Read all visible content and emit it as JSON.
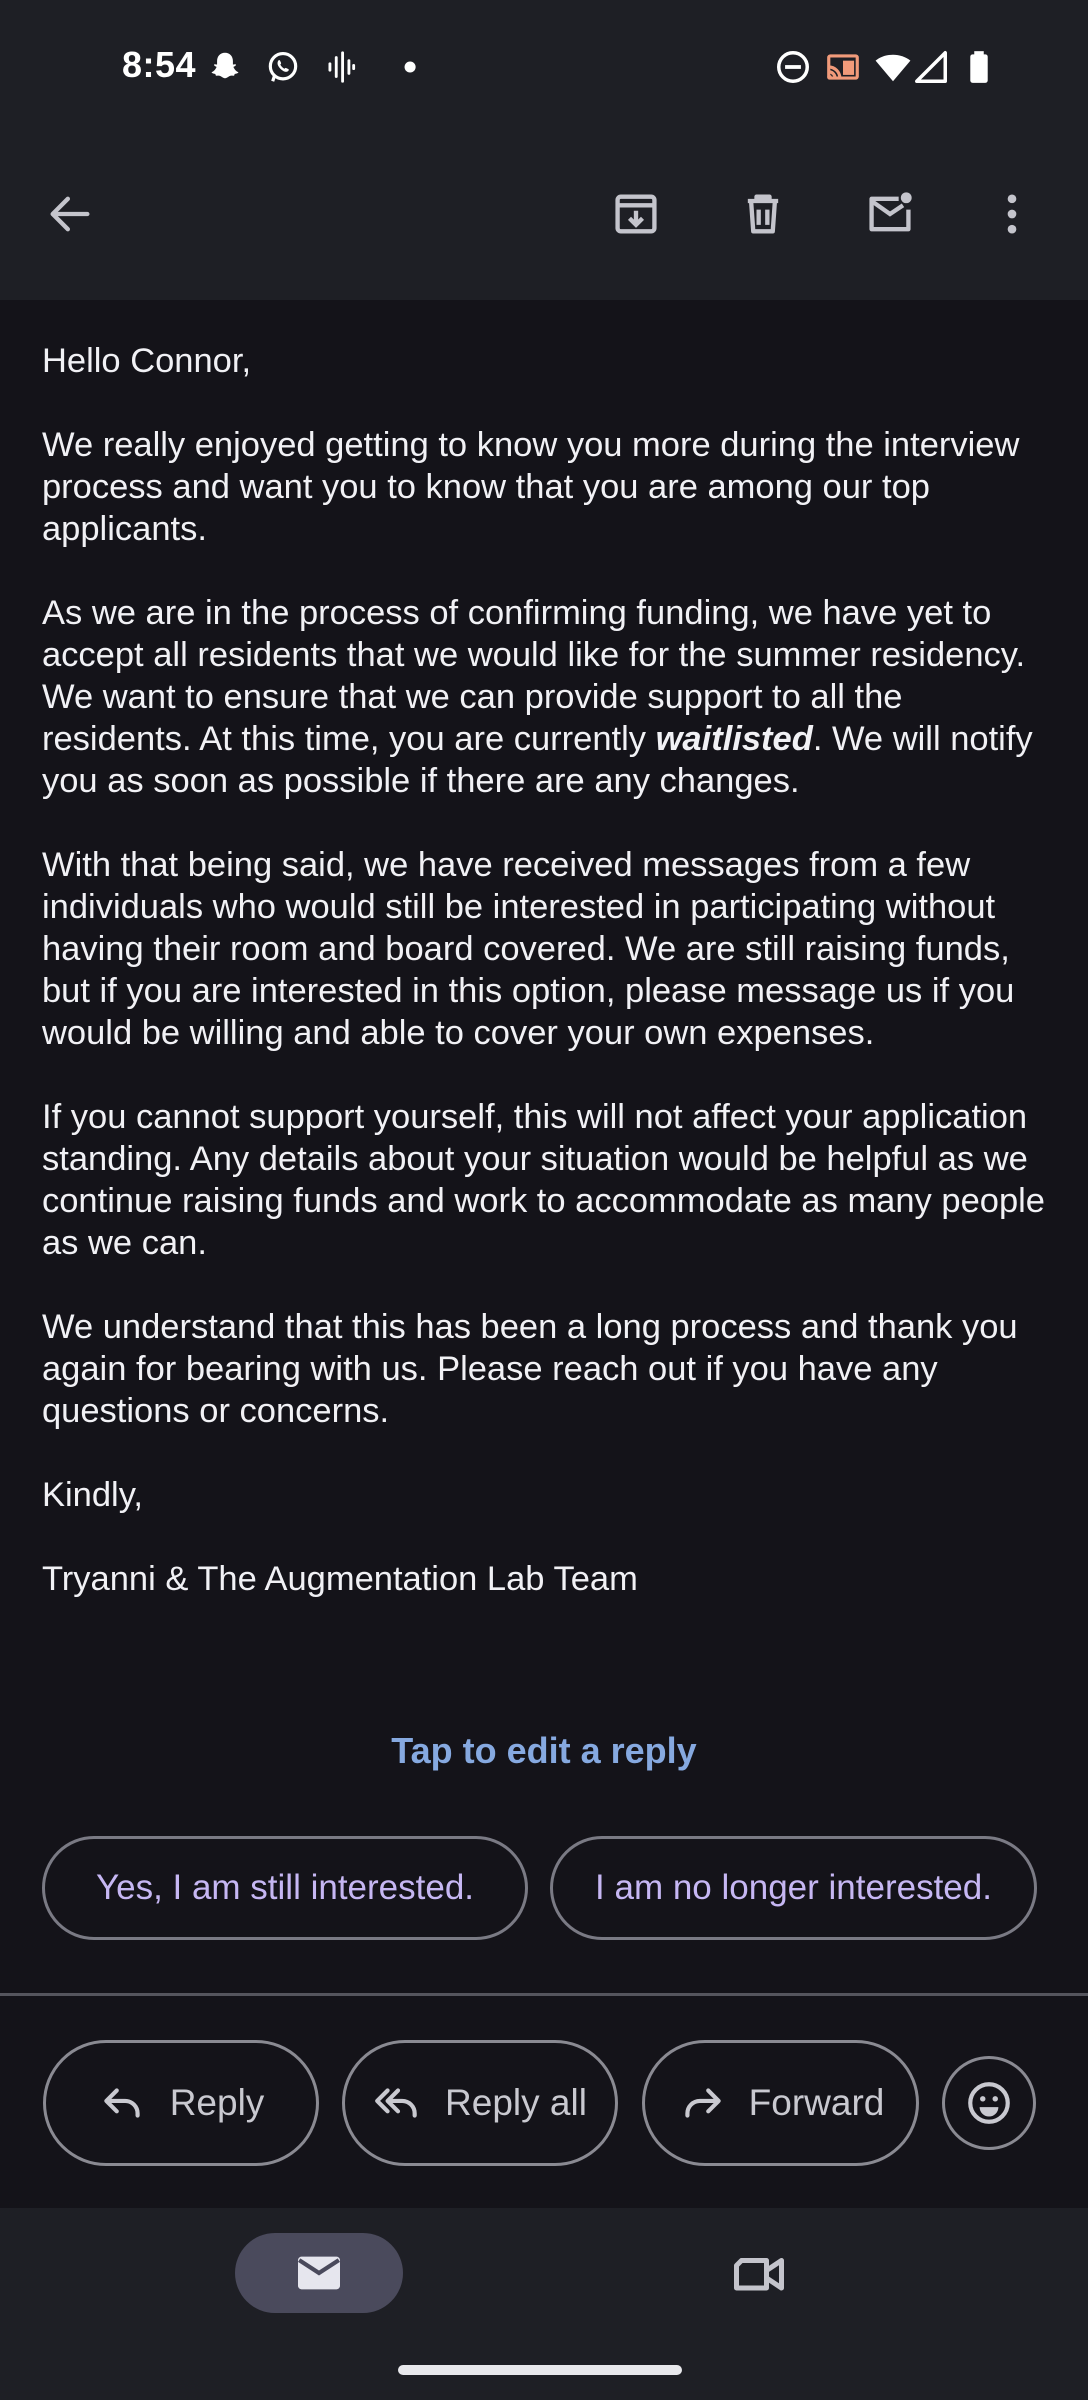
{
  "status_bar": {
    "time": "8:54",
    "left_icons": [
      "snapchat-icon",
      "whatsapp-icon",
      "sound-wave-icon",
      "dot-icon"
    ],
    "right_icons": [
      "do-not-disturb-icon",
      "cast-icon",
      "wifi-icon",
      "signal-icon",
      "battery-icon"
    ]
  },
  "toolbar": {
    "icons": [
      "back-arrow-icon",
      "archive-icon",
      "delete-icon",
      "mark-unread-icon",
      "more-vert-icon"
    ]
  },
  "email": {
    "greeting": "Hello Connor,",
    "p1": "We really enjoyed getting to know you more during the interview process and want you to know that you are among our top applicants.",
    "p2_before": "As we are in the process of confirming funding, we have yet to accept all residents that we would like for the summer residency. We want to ensure that we can provide support to all the residents. At this time, you are currently ",
    "p2_bold": "waitlisted",
    "p2_after": ". We will notify you as soon as possible if there are any changes.",
    "p3": "With that being said, we have received messages from a few individuals who would still be interested in participating without having their room and board covered. We are still raising funds, but if you are interested in this option, please message us if you would be willing and able to cover your own expenses.",
    "p4": "If you cannot support yourself, this will not affect your application standing. Any details about your situation would be helpful as we continue raising funds and work to accommodate as many people as we can.",
    "p5": "We understand that this has been a long process and thank you again for bearing with us. Please reach out if you have any questions or concerns.",
    "closing": "Kindly,",
    "signature": "Tryanni & The Augmentation Lab Team"
  },
  "smart_reply": {
    "hint": "Tap to edit a reply",
    "options": [
      "Yes, I am still interested.",
      "I am no longer interested."
    ]
  },
  "actions": {
    "reply": "Reply",
    "reply_all": "Reply all",
    "forward": "Forward",
    "emoji_icon": "emoji-react-icon"
  },
  "bottom_nav": {
    "items": [
      "mail-icon",
      "meet-video-icon"
    ],
    "selected": "mail-icon"
  },
  "colors": {
    "background": "#141319",
    "bar": "#1e1f25",
    "accent_link": "#86a9e0",
    "smart_reply_text": "#c6b7f3",
    "nav_pill": "#4a4a5c"
  }
}
